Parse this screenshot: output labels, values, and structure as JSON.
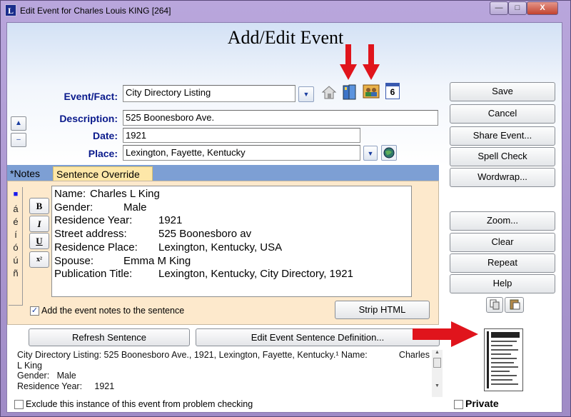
{
  "window": {
    "title": "Edit Event for Charles Louis KING [264]",
    "app_icon": "L",
    "minimize": "—",
    "maximize": "□",
    "close": "X"
  },
  "heading": "Add/Edit Event",
  "form": {
    "event_label": "Event/Fact:",
    "event_value": "City Directory Listing",
    "description_label": "Description:",
    "description_value": "525 Boonesboro Ave.",
    "date_label": "Date:",
    "date_value": "1921",
    "place_label": "Place:",
    "place_value": "Lexington, Fayette, Kentucky",
    "calendar_icon_text": "6"
  },
  "move_buttons": {
    "up": "▲",
    "down": "–"
  },
  "tabs": [
    {
      "label": "*Notes"
    },
    {
      "label": "Sentence Override"
    }
  ],
  "accents": [
    "■",
    "á",
    "é",
    "í",
    "ó",
    "ú",
    "ñ"
  ],
  "format_buttons": {
    "bold": "B",
    "italic": "I",
    "underline": "U",
    "superscript": "x²"
  },
  "notes": [
    [
      "Name:",
      "Charles L King"
    ],
    [
      "Gender:",
      "Male"
    ],
    [
      "Residence Year:",
      "1921"
    ],
    [
      "Street address:",
      "525 Boonesboro av"
    ],
    [
      "Residence Place:",
      "Lexington, Kentucky, USA"
    ],
    [
      "Spouse:",
      "Emma M King"
    ],
    [
      "Publication Title:",
      "Lexington, Kentucky, City Directory, 1921"
    ]
  ],
  "add_notes_checkbox": {
    "label": "Add the event notes to the sentence",
    "checked": true
  },
  "strip_html": "Strip HTML",
  "refresh_sentence": "Refresh Sentence",
  "edit_sentence_def": "Edit Event Sentence Definition...",
  "sentence": {
    "line1": "City Directory Listing: 525 Boonesboro Ave., 1921, Lexington, Fayette, Kentucky.¹ Name:",
    "line1_right": "Charles",
    "line2": "L King",
    "line3": "Gender:   Male",
    "line4": "Residence Year:     1921"
  },
  "exclude_checkbox": {
    "label": "Exclude this instance of this event from problem checking",
    "checked": false
  },
  "private_checkbox": {
    "label": "Private",
    "checked": false
  },
  "right_buttons": {
    "save": "Save",
    "cancel": "Cancel",
    "share": "Share Event...",
    "spell": "Spell Check",
    "wordwrap": "Wordwrap...",
    "zoom": "Zoom...",
    "clear": "Clear",
    "repeat": "Repeat",
    "help": "Help"
  },
  "colors": {
    "label": "#0a1a8c",
    "annotation_arrow": "#e0141c",
    "panel": "#fde9cc",
    "tab_bar": "#7d9fd4"
  }
}
